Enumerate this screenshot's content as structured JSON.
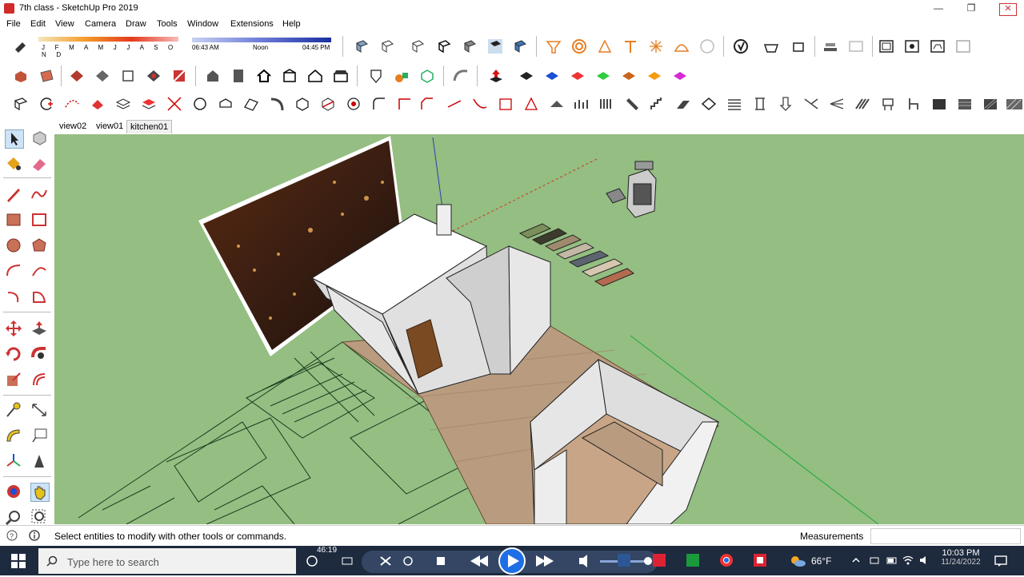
{
  "window": {
    "title": "7th class - SketchUp Pro 2019"
  },
  "menu": [
    "File",
    "Edit",
    "View",
    "Camera",
    "Draw",
    "Tools",
    "Window",
    "Extensions",
    "Help"
  ],
  "shadows": {
    "months": "J F M A M J J A S O N D",
    "time_start": "06:43 AM",
    "time_mid": "Noon",
    "time_end": "04:45 PM"
  },
  "scenes": [
    "view02",
    "view01",
    "kitchen01"
  ],
  "active_scene": "kitchen01",
  "status": {
    "message": "Select entities to modify with other tools or commands.",
    "measurements_label": "Measurements"
  },
  "taskbar": {
    "search_placeholder": "Type here to search",
    "video_time": "46:19",
    "temperature": "66°F",
    "clock_time": "10:03 PM",
    "clock_date": "11/24/2022"
  },
  "colors": {
    "viewport": "#94be82",
    "taskbar": "#1e2a3d",
    "floor": "#b99c80",
    "wall": "#e7e7e7"
  }
}
